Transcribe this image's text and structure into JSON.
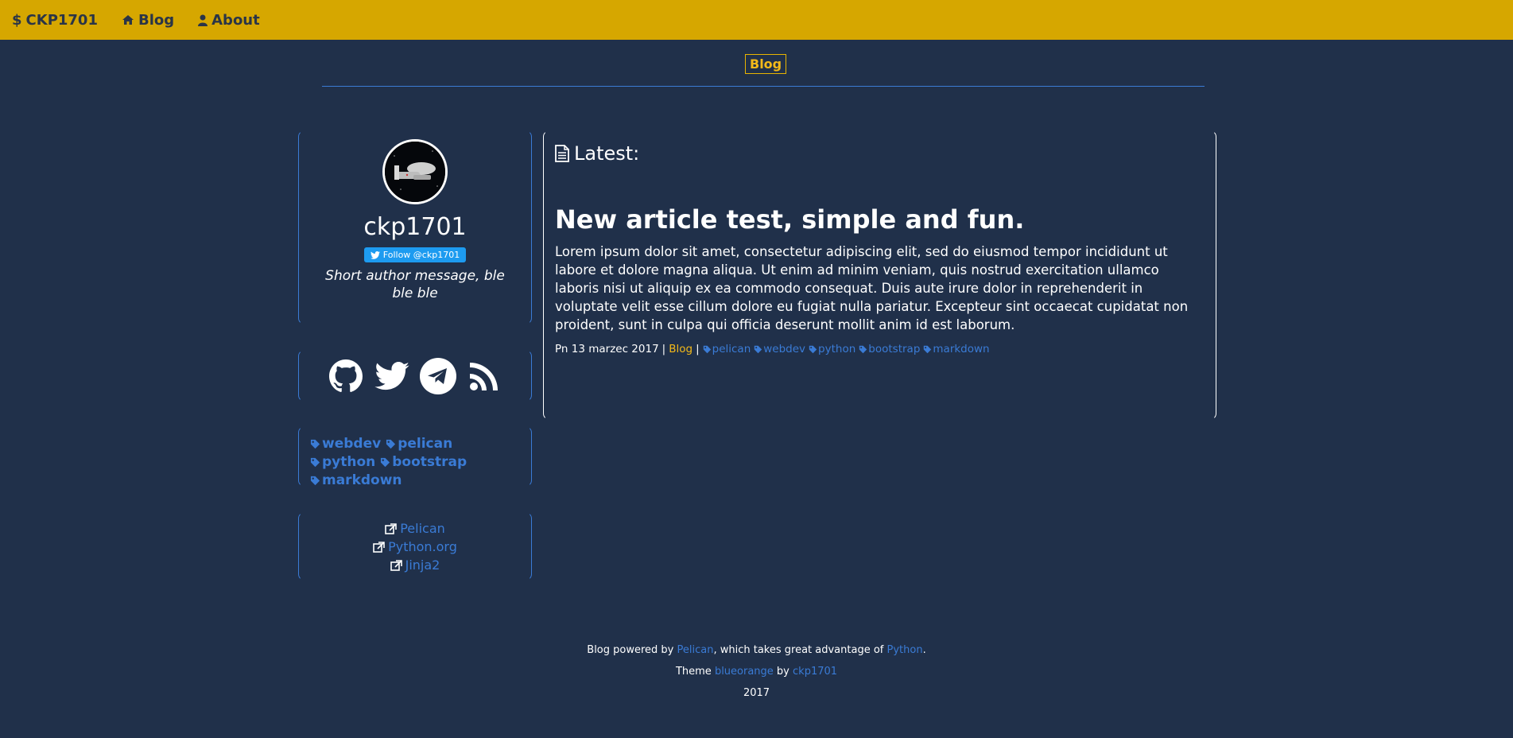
{
  "nav": {
    "brand": "CKP1701",
    "blog": "Blog",
    "about": "About"
  },
  "breadcrumb": "Blog",
  "author": {
    "name": "ckp1701",
    "follow_label": "Follow @ckp1701",
    "message": "Short author message, ble ble ble"
  },
  "social": {
    "icons": [
      "github-icon",
      "twitter-icon",
      "telegram-icon",
      "rss-icon"
    ]
  },
  "tags": [
    "webdev",
    "pelican",
    "python",
    "bootstrap",
    "markdown"
  ],
  "links": [
    "Pelican",
    "Python.org",
    "Jinja2"
  ],
  "main": {
    "latest_label": "Latest:",
    "article": {
      "title": "New article test, simple and fun.",
      "body": "Lorem ipsum dolor sit amet, consectetur adipiscing elit, sed do eiusmod tempor incididunt ut labore et dolore magna aliqua. Ut enim ad minim veniam, quis nostrud exercitation ullamco laboris nisi ut aliquip ex ea commodo consequat. Duis aute irure dolor in reprehenderit in voluptate velit esse cillum dolore eu fugiat nulla pariatur. Excepteur sint occaecat cupidatat non proident, sunt in culpa qui officia deserunt mollit anim id est laborum.",
      "date": "Pn 13 marzec 2017",
      "separator": "|",
      "category": "Blog",
      "tags": [
        "pelican",
        "webdev",
        "python",
        "bootstrap",
        "markdown"
      ]
    }
  },
  "footer": {
    "line1_prefix": "Blog powered by ",
    "line1_link1": "Pelican",
    "line1_middle": ", which takes great advantage of ",
    "line1_link2": "Python",
    "line1_suffix": ".",
    "line2_prefix": "Theme ",
    "line2_link1": "blueorange",
    "line2_middle": " by ",
    "line2_link2": "ckp1701",
    "year": "2017"
  },
  "colors": {
    "background": "#20304a",
    "navbar": "#d6a700",
    "accent_blue": "#3a7bd5",
    "accent_orange": "#f3b919"
  }
}
